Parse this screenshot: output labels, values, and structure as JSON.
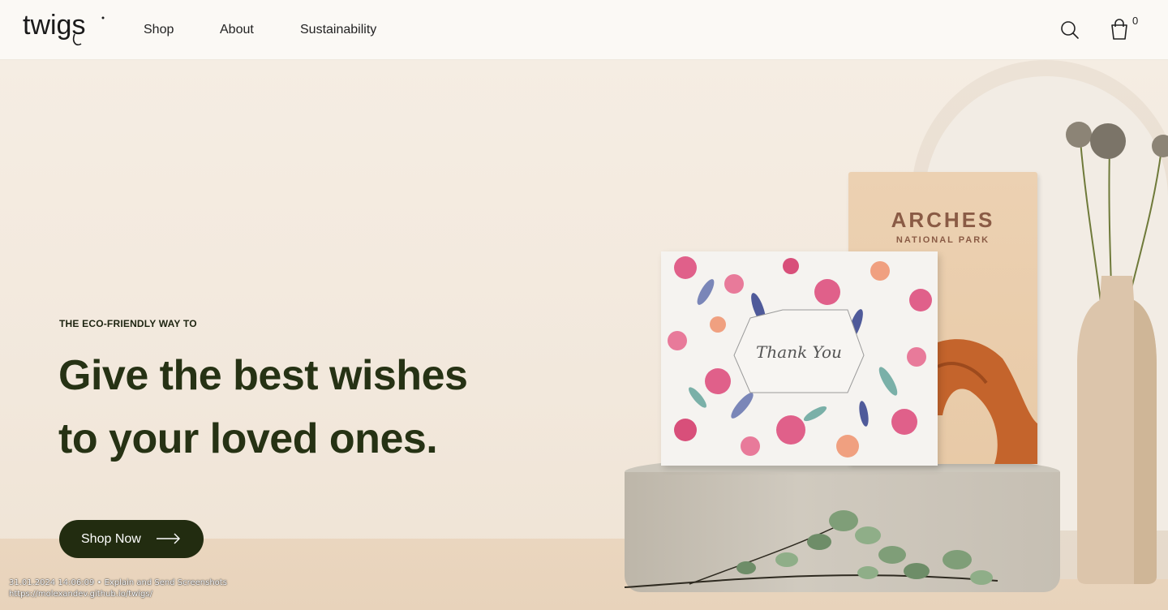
{
  "header": {
    "logo_text": "twigs",
    "nav": {
      "shop": "Shop",
      "about": "About",
      "sustainability": "Sustainability"
    },
    "cart_count": "0"
  },
  "hero": {
    "eyebrow": "THE ECO-FRIENDLY WAY TO",
    "headline_line1": "Give the best wishes",
    "headline_line2": "to your loved ones.",
    "cta_label": "Shop Now"
  },
  "illustration": {
    "card_back_title": "ARCHES",
    "card_back_subtitle": "NATIONAL PARK",
    "card_front_text": "Thank You"
  },
  "watermark": {
    "line1": "31.01.2024 14:06:09 • Explain and Send Screenshots",
    "line2": "https://molexandev.github.io/twigs/"
  },
  "colors": {
    "brand_dark": "#222c10",
    "headline": "#263214",
    "background": "#f5ede3"
  },
  "icons": {
    "search": "search-icon",
    "cart": "shopping-bag-icon",
    "arrow": "arrow-right-icon"
  }
}
